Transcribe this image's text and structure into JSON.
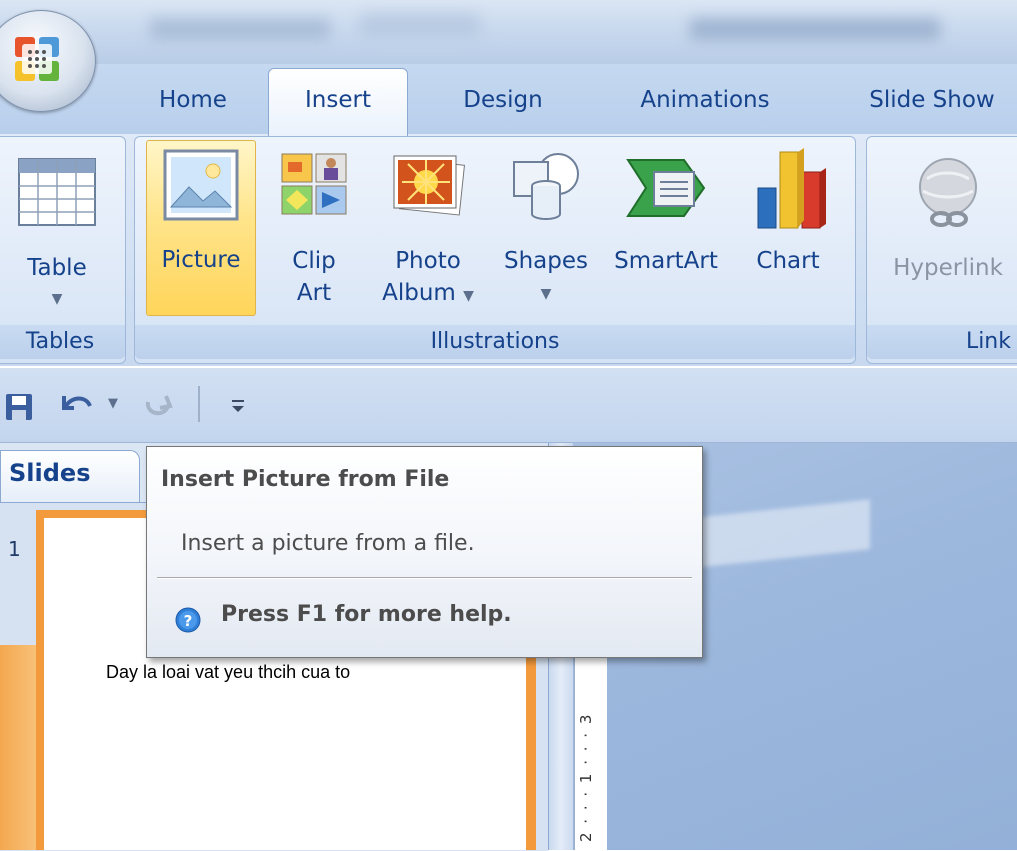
{
  "ribbon": {
    "tabs": [
      "Home",
      "Insert",
      "Design",
      "Animations",
      "Slide Show"
    ],
    "active_tab": "Insert",
    "groups": {
      "tables": {
        "label": "Tables",
        "buttons": {
          "table": "Table"
        }
      },
      "illustrations": {
        "label": "Illustrations",
        "buttons": {
          "picture": "Picture",
          "clip_art_1": "Clip",
          "clip_art_2": "Art",
          "photo_album_1": "Photo",
          "photo_album_2": "Album",
          "shapes": "Shapes",
          "smartart": "SmartArt",
          "chart": "Chart"
        }
      },
      "links": {
        "label": "Link",
        "buttons": {
          "hyperlink": "Hyperlink"
        }
      }
    }
  },
  "pane": {
    "slides_tab": "Slides",
    "slide_number": "1",
    "thumbnail_text": "Day la loai vat yeu thcih cua to"
  },
  "ruler": {
    "marks": "2 · · · 1 · · · 3"
  },
  "tooltip": {
    "title": "Insert Picture from File",
    "description": "Insert a picture from a file.",
    "help": "Press F1 for more help."
  },
  "colors": {
    "ribbon_text": "#15428b",
    "picture_highlight": "#ffd55a",
    "slide_border": "#f39a3c"
  },
  "icons": [
    "office-button-icon",
    "table-icon",
    "picture-icon",
    "clip-art-icon",
    "photo-album-icon",
    "shapes-icon",
    "smartart-icon",
    "chart-icon",
    "hyperlink-icon",
    "save-icon",
    "undo-icon",
    "redo-icon",
    "customize-qat-icon",
    "help-icon"
  ]
}
